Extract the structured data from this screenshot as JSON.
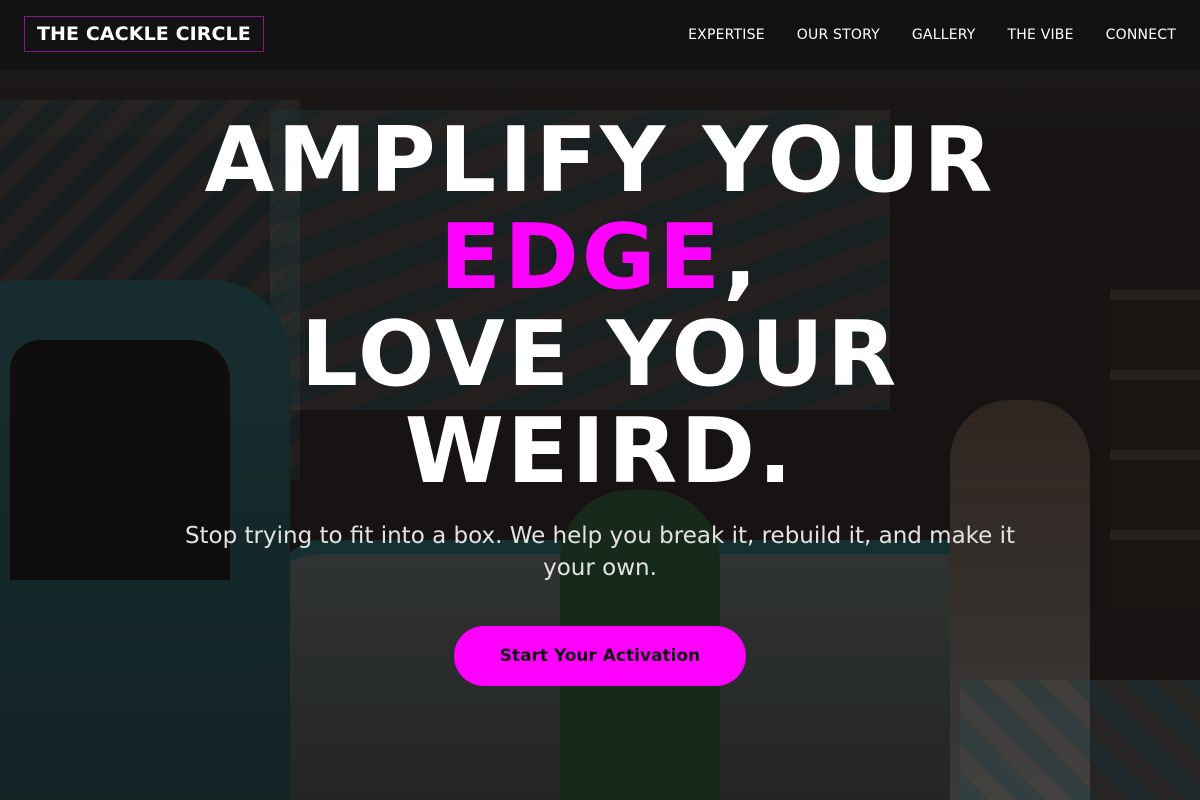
{
  "brand": {
    "logo_text": "THE CACKLE CIRCLE",
    "accent_color": "#ff00ff"
  },
  "nav": {
    "items": [
      {
        "label": "EXPERTISE"
      },
      {
        "label": "OUR STORY"
      },
      {
        "label": "GALLERY"
      },
      {
        "label": "THE VIBE"
      },
      {
        "label": "CONNECT"
      }
    ]
  },
  "hero": {
    "headline": {
      "line1": "AMPLIFY YOUR",
      "line2_accent": "EDGE",
      "line2_rest": ",",
      "line3": "LOVE YOUR",
      "line4": "WEIRD."
    },
    "subtitle": "Stop trying to fit into a box. We help you break it, rebuild it, and make it your own.",
    "cta_label": "Start Your Activation"
  }
}
